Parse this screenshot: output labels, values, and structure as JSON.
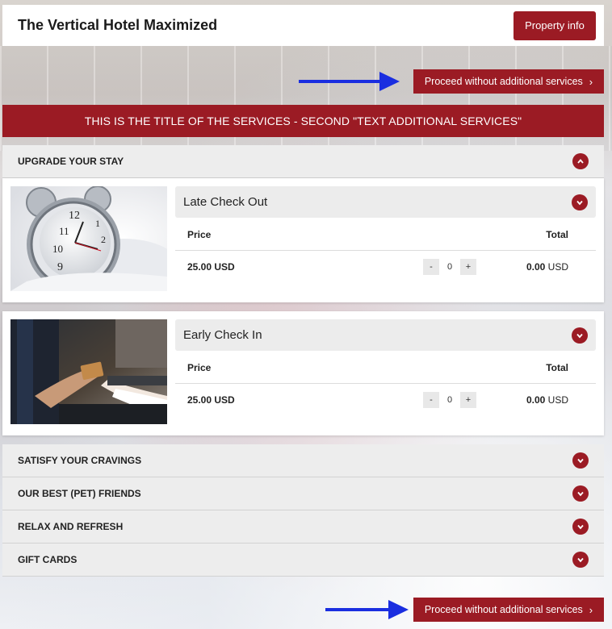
{
  "header": {
    "hotel_name": "The Vertical Hotel Maximized",
    "property_info_label": "Property info"
  },
  "proceed_label": "Proceed without additional services",
  "services_title": "THIS IS THE TITLE OF THE SERVICES - SECOND \"TEXT ADDITIONAL SERVICES\"",
  "sections": {
    "upgrade": "UPGRADE YOUR STAY",
    "cravings": "SATISFY YOUR CRAVINGS",
    "pets": "OUR BEST (PET) FRIENDS",
    "relax": "RELAX AND REFRESH",
    "gift": "GIFT CARDS"
  },
  "services": [
    {
      "name": "Late Check Out",
      "price_header": "Price",
      "total_header": "Total",
      "price": "25.00 USD",
      "quantity": "0",
      "total_amount": "0.00",
      "total_currency": "USD",
      "image_icon": "alarm-clock-photo"
    },
    {
      "name": "Early Check In",
      "price_header": "Price",
      "total_header": "Total",
      "price": "25.00 USD",
      "quantity": "0",
      "total_amount": "0.00",
      "total_currency": "USD",
      "image_icon": "card-handover-photo"
    }
  ],
  "stepper": {
    "minus": "-",
    "plus": "+"
  },
  "colors": {
    "brand": "#9b1b24",
    "arrow": "#1a2ee0"
  }
}
